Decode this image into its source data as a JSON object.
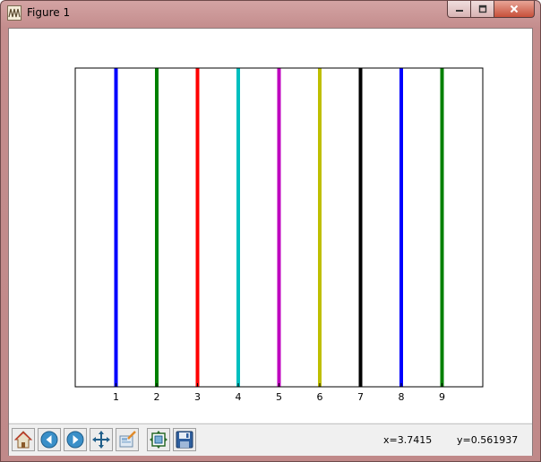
{
  "window": {
    "title": "Figure 1",
    "icon": "matplotlib-figure-icon"
  },
  "title_buttons": {
    "minimize": "minimize-icon",
    "maximize": "maximize-icon",
    "close": "close-icon"
  },
  "toolbar": {
    "buttons": [
      {
        "name": "home-button",
        "icon": "home-icon"
      },
      {
        "name": "back-button",
        "icon": "back-arrow-icon"
      },
      {
        "name": "forward-button",
        "icon": "forward-arrow-icon"
      },
      {
        "name": "pan-button",
        "icon": "move-arrows-icon"
      },
      {
        "name": "zoom-button",
        "icon": "zoom-rect-icon"
      },
      {
        "name": "subplots-button",
        "icon": "subplots-config-icon"
      },
      {
        "name": "save-button",
        "icon": "floppy-save-icon"
      }
    ],
    "x_readout": "x=3.7415",
    "y_readout": "y=0.561937"
  },
  "chart_data": {
    "type": "vlines",
    "x": [
      1,
      2,
      3,
      4,
      5,
      6,
      7,
      8,
      9
    ],
    "colors": [
      "#0000ff",
      "#008000",
      "#ff0000",
      "#00bfbf",
      "#bf00bf",
      "#bfbf00",
      "#000000",
      "#0000ff",
      "#008000"
    ],
    "xticks": [
      "1",
      "2",
      "3",
      "4",
      "5",
      "6",
      "7",
      "8",
      "9"
    ],
    "xlim": [
      0,
      10
    ],
    "ylim": [
      0,
      1
    ],
    "yticks_visible": false,
    "grid": false,
    "title": "",
    "xlabel": "",
    "ylabel": ""
  }
}
